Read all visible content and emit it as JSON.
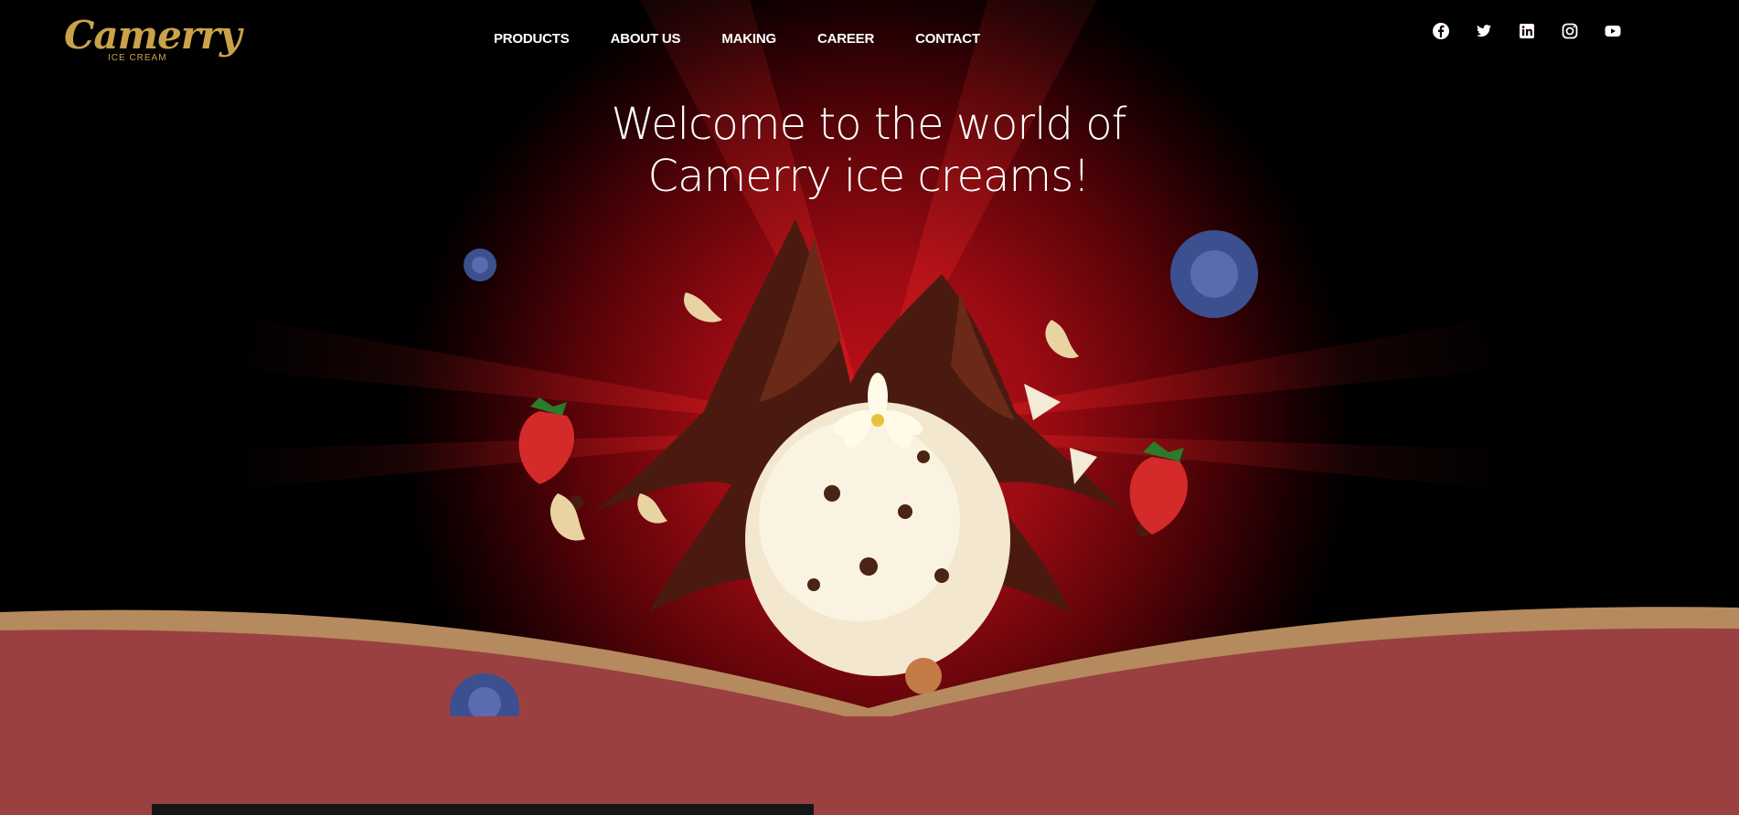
{
  "brand": {
    "name": "Camerry",
    "tagline": "ICE CREAM"
  },
  "nav": [
    {
      "label": "PRODUCTS"
    },
    {
      "label": "ABOUT US"
    },
    {
      "label": "MAKING"
    },
    {
      "label": "CAREER"
    },
    {
      "label": "CONTACT"
    }
  ],
  "social": [
    {
      "icon": "facebook-icon"
    },
    {
      "icon": "twitter-icon"
    },
    {
      "icon": "linkedin-icon"
    },
    {
      "icon": "instagram-icon"
    },
    {
      "icon": "youtube-icon"
    }
  ],
  "hero": {
    "line1": "Welcome to the world of",
    "line2": "Camerry ice creams!"
  },
  "colors": {
    "gold": "#c9a24a",
    "band": "#9b4040",
    "hero_red": "#c4121a"
  }
}
